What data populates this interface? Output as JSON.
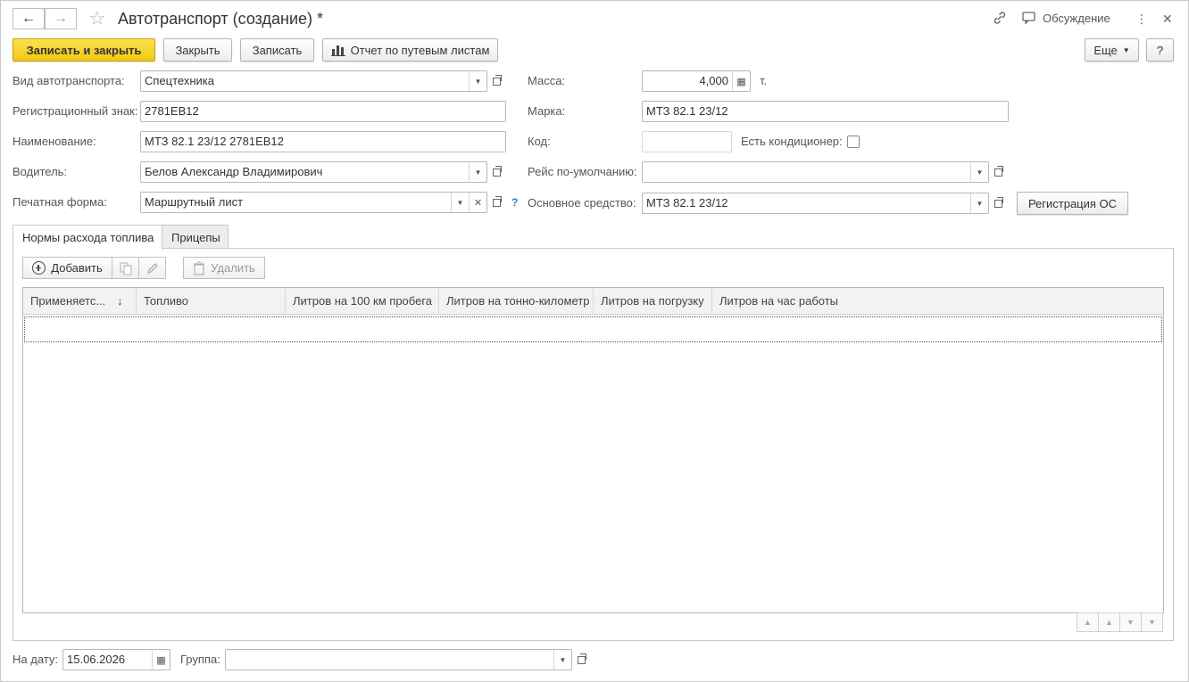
{
  "window": {
    "title": "Автотранспорт (создание) *",
    "discuss_label": "Обсуждение"
  },
  "toolbar": {
    "save_close_label": "Записать и закрыть",
    "close_label": "Закрыть",
    "save_label": "Записать",
    "report_label": "Отчет по путевым листам",
    "more_label": "Еще",
    "help_label": "?"
  },
  "form": {
    "vehicle_type": {
      "label": "Вид автотранспорта:",
      "value": "Спецтехника"
    },
    "reg_number": {
      "label": "Регистрационный знак:",
      "value": "2781ЕВ12"
    },
    "name": {
      "label": "Наименование:",
      "value": "МТЗ 82.1 23/12 2781ЕВ12"
    },
    "driver": {
      "label": "Водитель:",
      "value": "Белов Александр Владимирович"
    },
    "print_form": {
      "label": "Печатная форма:",
      "value": "Маршрутный лист",
      "help": "?"
    },
    "mass": {
      "label": "Масса:",
      "value": "4,000",
      "unit": "т."
    },
    "brand": {
      "label": "Марка:",
      "value": "МТЗ 82.1 23/12"
    },
    "code": {
      "label": "Код:",
      "value": ""
    },
    "air_conditioner": {
      "label": "Есть кондиционер:",
      "checked": false
    },
    "default_trip": {
      "label": "Рейс по-умолчанию:",
      "value": ""
    },
    "fixed_asset": {
      "label": "Основное средство:",
      "value": "МТЗ 82.1 23/12"
    },
    "register_asset_label": "Регистрация ОС"
  },
  "tabs": [
    {
      "label": "Нормы расхода топлива",
      "active": true
    },
    {
      "label": "Прицепы",
      "active": false
    }
  ],
  "table_toolbar": {
    "add_label": "Добавить",
    "delete_label": "Удалить"
  },
  "table": {
    "columns": [
      "Применяетс...",
      "Топливо",
      "Литров на 100 км пробега",
      "Литров на тонно-километр",
      "Литров на погрузку",
      "Литров на час работы"
    ],
    "sort_indicator": "↓",
    "rows": []
  },
  "footer": {
    "date": {
      "label": "На дату:",
      "value": "15.06.2026"
    },
    "group": {
      "label": "Группа:",
      "value": ""
    }
  },
  "colors": {
    "primary_button": "#f5cf1f",
    "help_accent": "#2f80c7"
  }
}
